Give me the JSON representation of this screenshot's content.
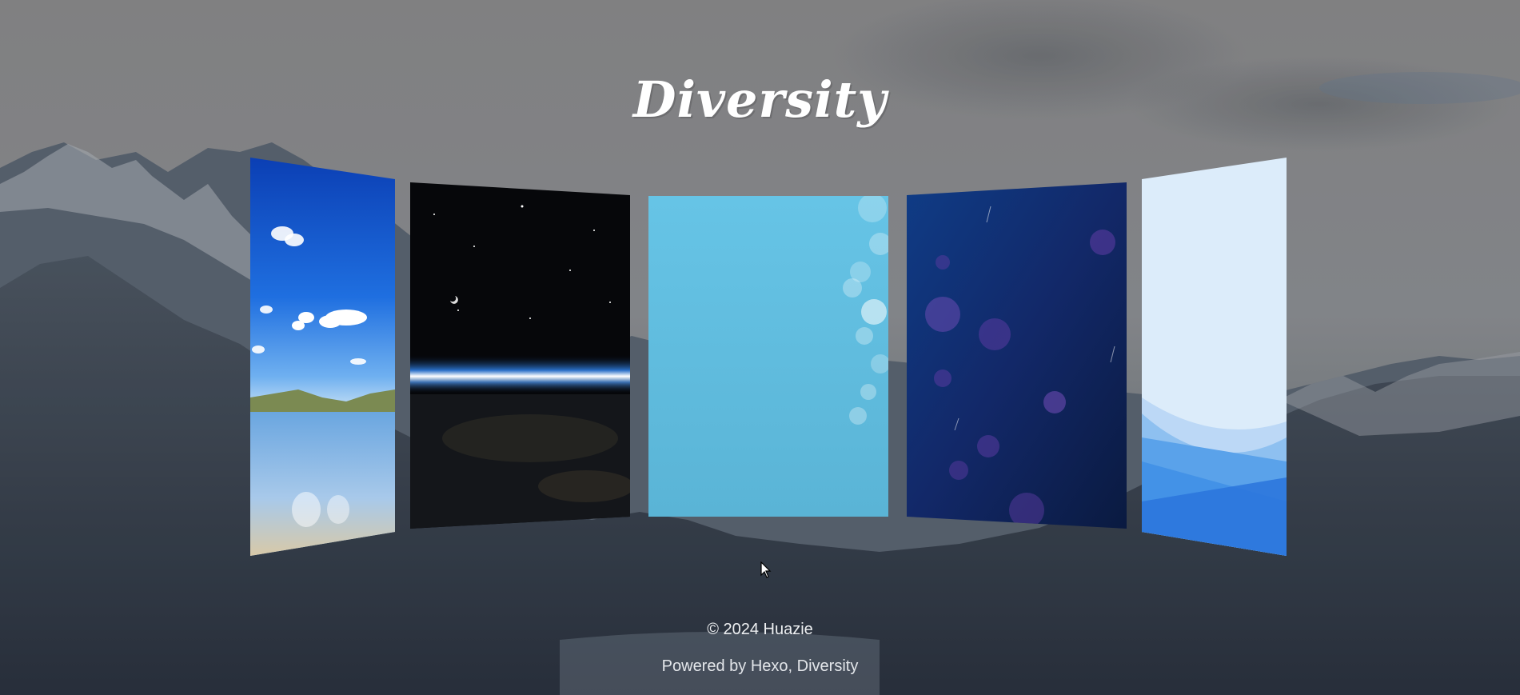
{
  "site": {
    "title": "Diversity"
  },
  "carousel": {
    "cards": [
      {
        "name": "card-lake-sky",
        "depicts": "lake-sky-image"
      },
      {
        "name": "card-space-earth",
        "depicts": "space-horizon-image"
      },
      {
        "name": "card-light-blue-bokeh",
        "depicts": "blue-bokeh-image"
      },
      {
        "name": "card-navy-bubbles",
        "depicts": "navy-bubbles-image"
      },
      {
        "name": "card-blue-waves",
        "depicts": "blue-waves-image"
      }
    ]
  },
  "footer": {
    "copyright": "© 2024 Huazie",
    "powered_prefix": "Powered by ",
    "hexo_link": "Hexo",
    "separator": ", ",
    "theme_link": "Diversity"
  },
  "colors": {
    "title_text": "#ffffff",
    "footer_text": "#eef0f2",
    "backdrop_sky": "#8c8d90",
    "backdrop_mountains": "#4b5560"
  }
}
